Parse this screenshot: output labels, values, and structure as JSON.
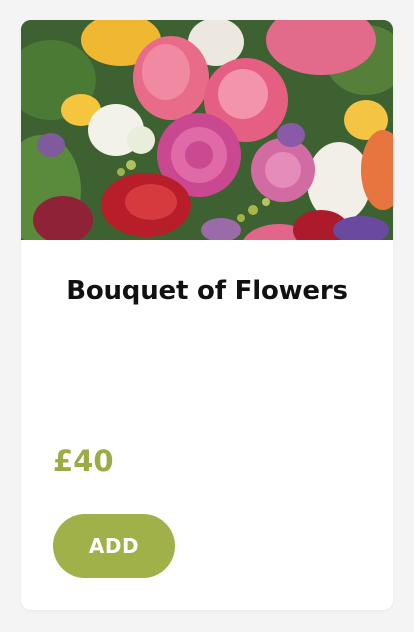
{
  "product": {
    "title": "Bouquet of Flowers",
    "price": "£40",
    "add_label": "ADD",
    "image_subject": "mixed-flower-bouquet"
  },
  "colors": {
    "accent": "#a0b14a",
    "price": "#9aad45",
    "title": "#111111",
    "card_bg": "#ffffff",
    "page_bg": "#f4f4f4"
  }
}
